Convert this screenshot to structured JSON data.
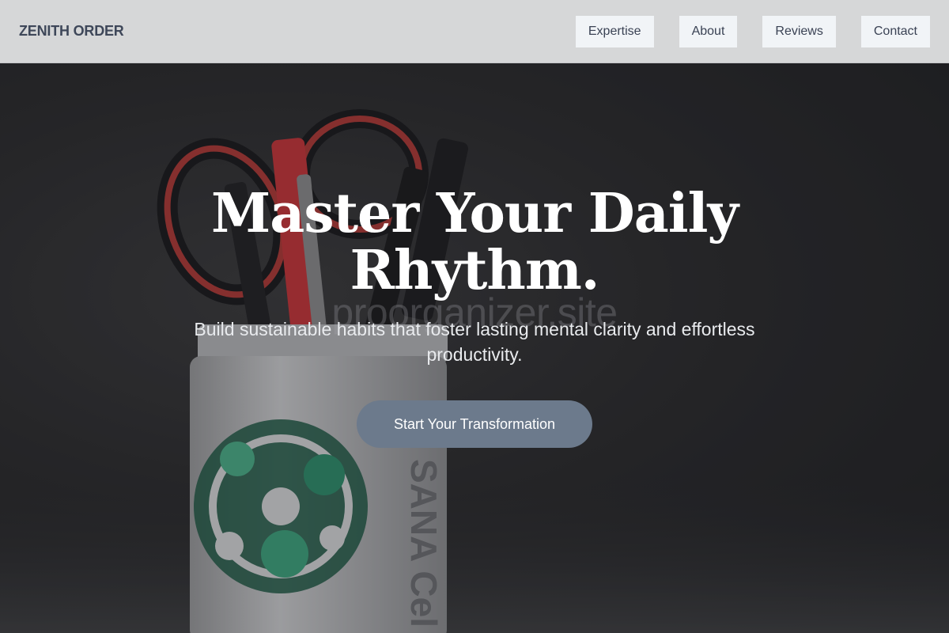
{
  "header": {
    "brand": "ZENITH ORDER",
    "nav": [
      {
        "label": "Expertise"
      },
      {
        "label": "About"
      },
      {
        "label": "Reviews"
      },
      {
        "label": "Contact"
      }
    ]
  },
  "hero": {
    "title": "Master Your Daily Rhythm.",
    "subtitle": "Build sustainable habits that foster lasting mental clarity and effortless productivity.",
    "cta_label": "Start Your Transformation",
    "watermark": "proorganizer.site",
    "jar_label": "SANA Cel",
    "image_subject": "pen-jar-with-scissors-and-markers"
  },
  "colors": {
    "header_bg": "#d6d7d8",
    "nav_button_bg": "#f1f4f7",
    "brand_text": "#3e4759",
    "cta_bg": "#6c7a8c",
    "hero_text": "#ffffff"
  }
}
